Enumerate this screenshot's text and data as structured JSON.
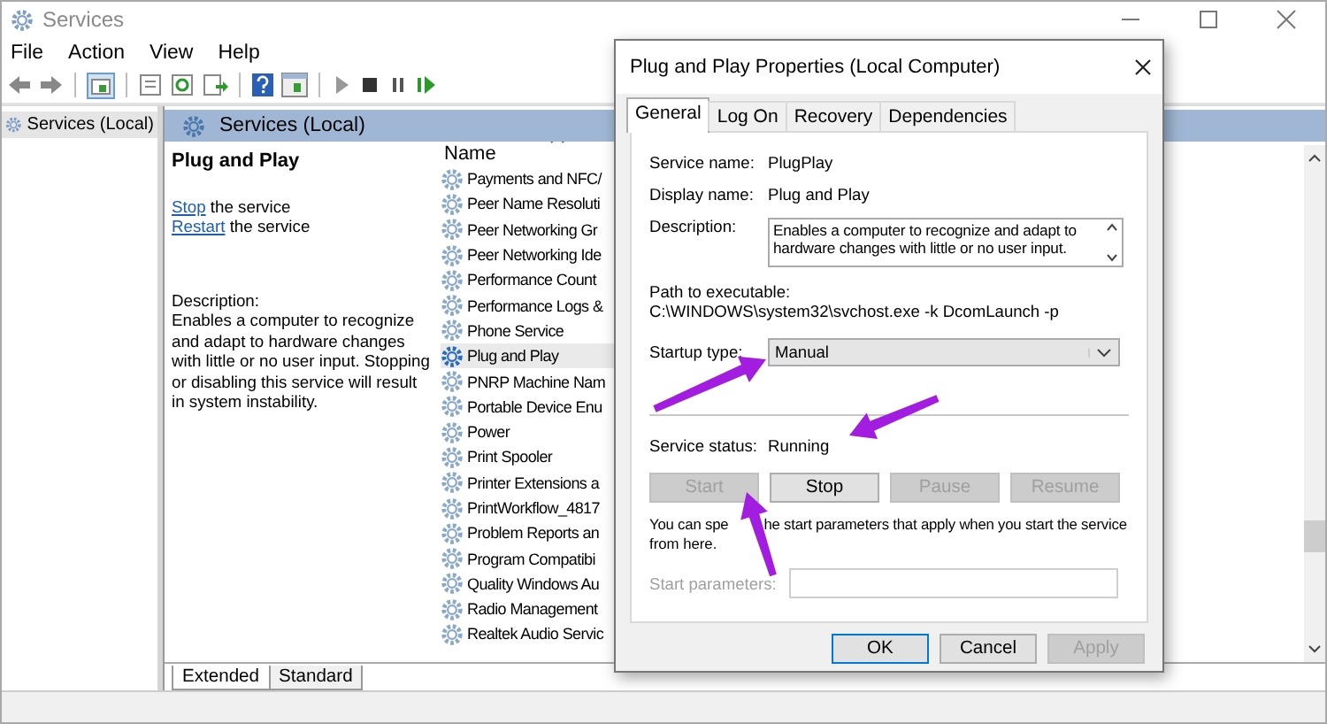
{
  "window": {
    "title": "Services"
  },
  "menu": [
    "File",
    "Action",
    "View",
    "Help"
  ],
  "tree": [
    {
      "label": "Services (Local)",
      "selected": true
    }
  ],
  "pane_header": "Services (Local)",
  "detail": {
    "title": "Plug and Play",
    "actions": [
      {
        "link": "Stop",
        "text": "the service"
      },
      {
        "link": "Restart",
        "text": "the service"
      }
    ],
    "description_label": "Description:",
    "description": "Enables a computer to recognize and adapt to hardware changes with little or no user input. Stopping or disabling this service will result in system instability."
  },
  "list": {
    "column": "Name",
    "rows": [
      {
        "name": "Payments and NFC/",
        "selected": false
      },
      {
        "name": "Peer Name Resoluti",
        "selected": false
      },
      {
        "name": "Peer Networking Gr",
        "selected": false
      },
      {
        "name": "Peer Networking Ide",
        "selected": false
      },
      {
        "name": "Performance Count",
        "selected": false
      },
      {
        "name": "Performance Logs &",
        "selected": false
      },
      {
        "name": "Phone Service",
        "selected": false
      },
      {
        "name": "Plug and Play",
        "selected": true
      },
      {
        "name": "PNRP Machine Nam",
        "selected": false
      },
      {
        "name": "Portable Device Enu",
        "selected": false
      },
      {
        "name": "Power",
        "selected": false
      },
      {
        "name": "Print Spooler",
        "selected": false
      },
      {
        "name": "Printer Extensions a",
        "selected": false
      },
      {
        "name": "PrintWorkflow_4817",
        "selected": false
      },
      {
        "name": "Problem Reports an",
        "selected": false
      },
      {
        "name": "Program Compatibi",
        "selected": false
      },
      {
        "name": "Quality Windows Au",
        "selected": false
      },
      {
        "name": "Radio Management",
        "selected": false
      },
      {
        "name": "Realtek Audio Servic",
        "selected": false
      }
    ]
  },
  "view_tabs": [
    {
      "label": "Extended",
      "selected": true
    },
    {
      "label": "Standard",
      "selected": false
    }
  ],
  "dialog": {
    "title": "Plug and Play Properties (Local Computer)",
    "tabs": [
      {
        "label": "General",
        "selected": true
      },
      {
        "label": "Log On",
        "selected": false
      },
      {
        "label": "Recovery",
        "selected": false
      },
      {
        "label": "Dependencies",
        "selected": false
      }
    ],
    "service_name": {
      "label": "Service name:",
      "value": "PlugPlay"
    },
    "display_name": {
      "label": "Display name:",
      "value": "Plug and Play"
    },
    "description": {
      "label": "Description:",
      "value": "Enables a computer to recognize and adapt to hardware changes with little or no user input."
    },
    "path": {
      "label": "Path to executable:",
      "value": "C:\\WINDOWS\\system32\\svchost.exe -k DcomLaunch -p"
    },
    "startup_type": {
      "label": "Startup type:",
      "value": "Manual"
    },
    "service_status": {
      "label": "Service status:",
      "value": "Running"
    },
    "service_buttons": [
      {
        "label": "Start",
        "disabled": true
      },
      {
        "label": "Stop",
        "disabled": false
      },
      {
        "label": "Pause",
        "disabled": true
      },
      {
        "label": "Resume",
        "disabled": true
      }
    ],
    "hint": [
      "You can spe",
      "he start parameters that apply when you start the service",
      "from here."
    ],
    "start_parameters": {
      "label": "Start parameters:",
      "disabled": true
    },
    "buttons": [
      {
        "label": "OK",
        "disabled": false,
        "default": true
      },
      {
        "label": "Cancel",
        "disabled": false,
        "default": false
      },
      {
        "label": "Apply",
        "disabled": true,
        "default": false
      }
    ]
  }
}
